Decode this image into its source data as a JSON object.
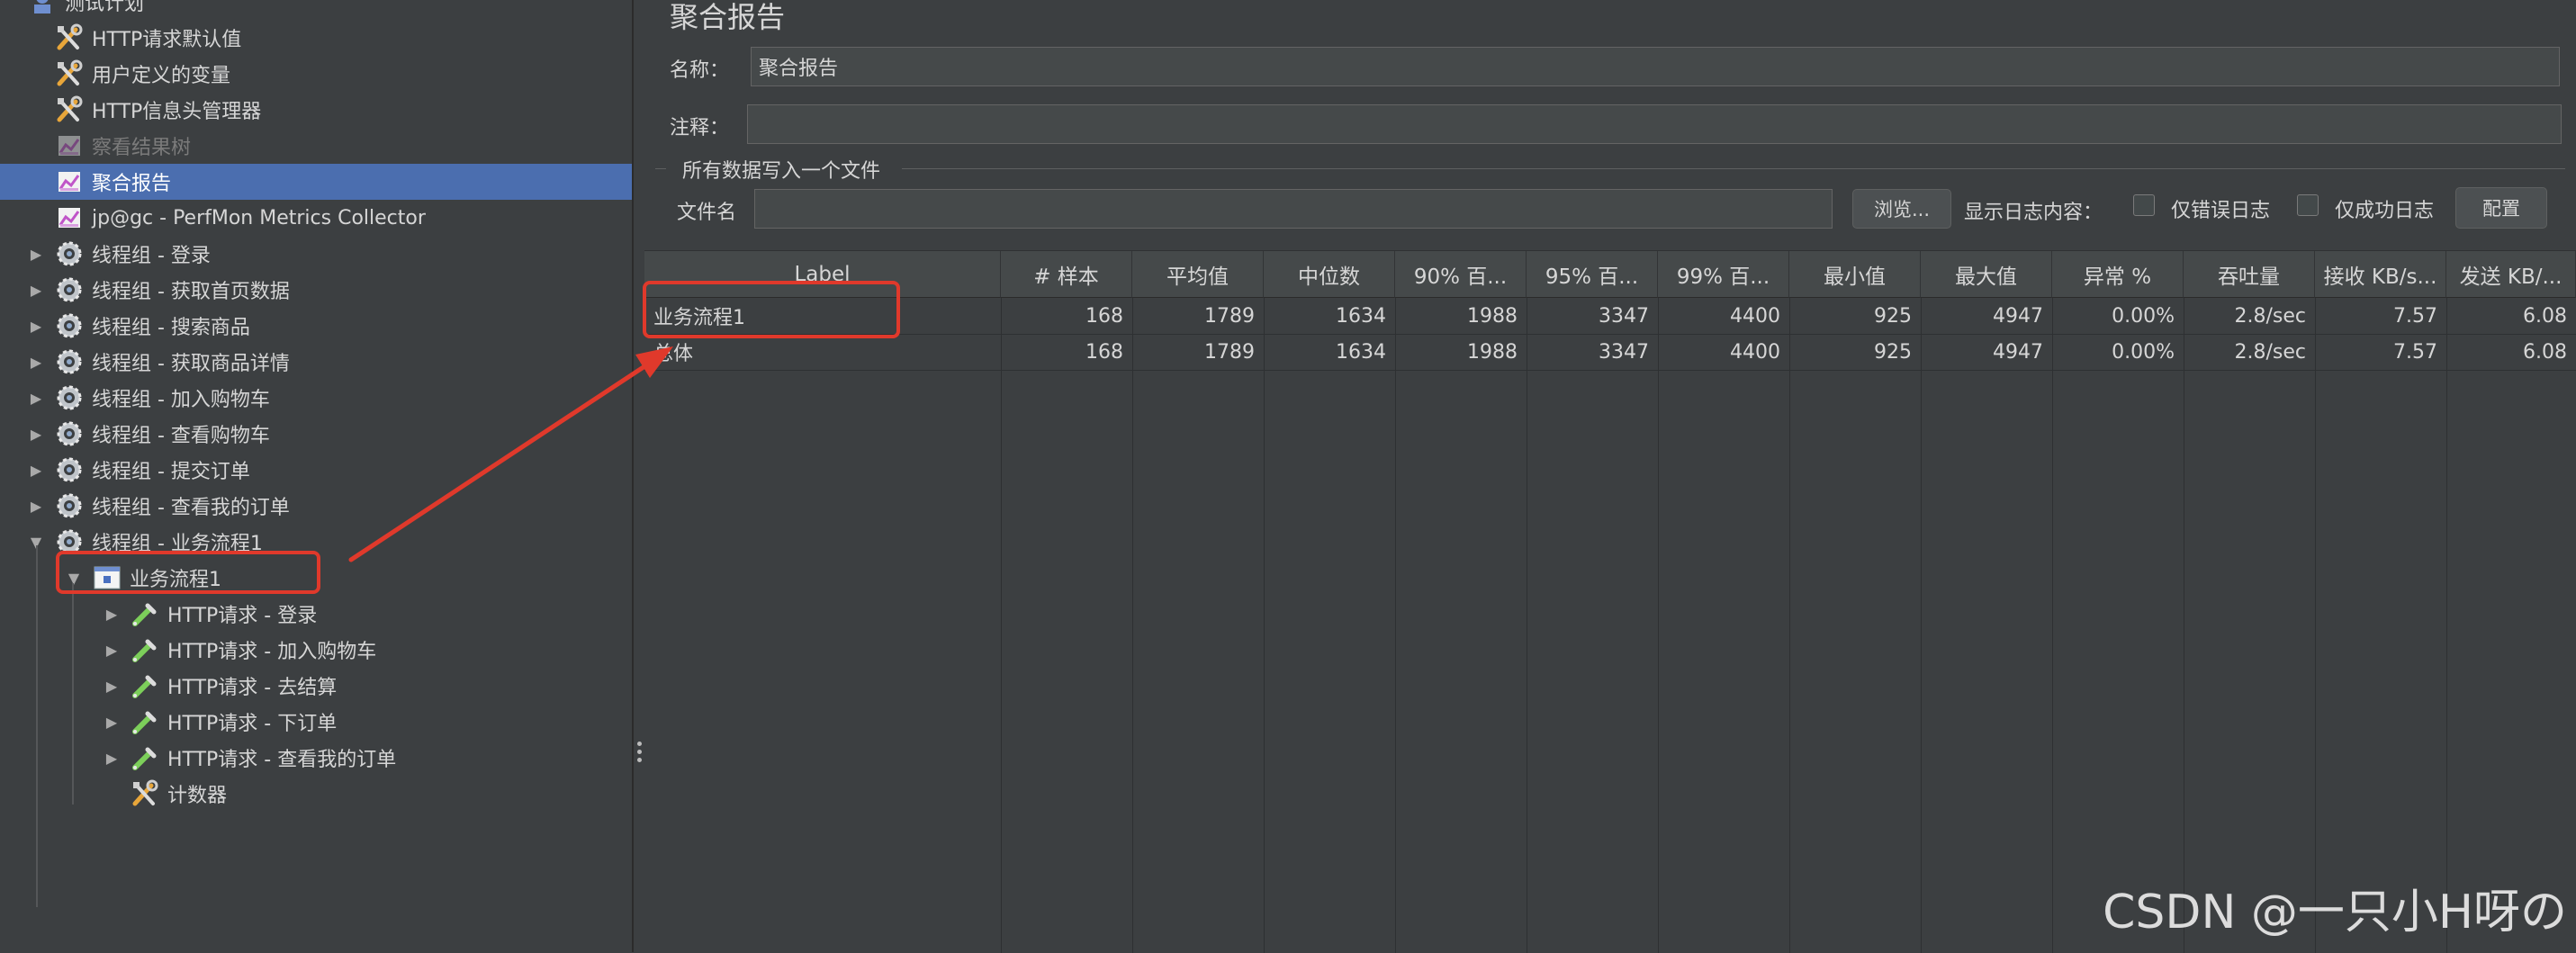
{
  "tree": {
    "items": [
      {
        "label": "测试计划",
        "level": 0,
        "icon": "test-plan-icon"
      },
      {
        "label": "HTTP请求默认值",
        "level": 1,
        "icon": "wrench-icon"
      },
      {
        "label": "用户定义的变量",
        "level": 1,
        "icon": "wrench-icon"
      },
      {
        "label": "HTTP信息头管理器",
        "level": 1,
        "icon": "wrench-icon"
      },
      {
        "label": "察看结果树",
        "level": 1,
        "icon": "listener-chart-icon",
        "disabled": true
      },
      {
        "label": "聚合报告",
        "level": 1,
        "icon": "listener-chart-icon",
        "selected": true
      },
      {
        "label": "jp@gc - PerfMon Metrics Collector",
        "level": 1,
        "icon": "listener-chart-icon"
      },
      {
        "label": "线程组 - 登录",
        "level": 1,
        "icon": "gear-icon",
        "expandable": true
      },
      {
        "label": "线程组 - 获取首页数据",
        "level": 1,
        "icon": "gear-icon",
        "expandable": true
      },
      {
        "label": "线程组 - 搜索商品",
        "level": 1,
        "icon": "gear-icon",
        "expandable": true
      },
      {
        "label": "线程组 - 获取商品详情",
        "level": 1,
        "icon": "gear-icon",
        "expandable": true
      },
      {
        "label": "线程组 - 加入购物车",
        "level": 1,
        "icon": "gear-icon",
        "expandable": true
      },
      {
        "label": "线程组 - 查看购物车",
        "level": 1,
        "icon": "gear-icon",
        "expandable": true
      },
      {
        "label": "线程组 - 提交订单",
        "level": 1,
        "icon": "gear-icon",
        "expandable": true
      },
      {
        "label": "线程组 - 查看我的订单",
        "level": 1,
        "icon": "gear-icon",
        "expandable": true
      },
      {
        "label": "线程组 - 业务流程1",
        "level": 1,
        "icon": "gear-icon",
        "expandable": true,
        "expanded": true
      },
      {
        "label": "业务流程1",
        "level": 2,
        "icon": "transaction-controller-icon",
        "expandable": true,
        "expanded": true
      },
      {
        "label": "HTTP请求 - 登录",
        "level": 3,
        "icon": "pipette-icon",
        "expandable": true
      },
      {
        "label": "HTTP请求 - 加入购物车",
        "level": 3,
        "icon": "pipette-icon",
        "expandable": true
      },
      {
        "label": "HTTP请求 - 去结算",
        "level": 3,
        "icon": "pipette-icon",
        "expandable": true
      },
      {
        "label": "HTTP请求 - 下订单",
        "level": 3,
        "icon": "pipette-icon",
        "expandable": true
      },
      {
        "label": "HTTP请求 - 查看我的订单",
        "level": 3,
        "icon": "pipette-icon",
        "expandable": true
      },
      {
        "label": "计数器",
        "level": 3,
        "icon": "wrench-icon"
      }
    ]
  },
  "panel": {
    "title": "聚合报告",
    "name_label": "名称：",
    "name_value": "聚合报告",
    "comment_label": "注释：",
    "comment_value": "",
    "file_section_title": "所有数据写入一个文件",
    "file_label": "文件名",
    "file_value": "",
    "browse_button": "浏览...",
    "log_content_label": "显示日志内容：",
    "errors_only_label": "仅错误日志",
    "success_only_label": "仅成功日志",
    "configure_button": "配置"
  },
  "table": {
    "columns": [
      "Label",
      "# 样本",
      "平均值",
      "中位数",
      "90% 百...",
      "95% 百...",
      "99% 百...",
      "最小值",
      "最大值",
      "异常 %",
      "吞吐量",
      "接收 KB/s...",
      "发送 KB/..."
    ],
    "rows": [
      [
        "业务流程1",
        "168",
        "1789",
        "1634",
        "1988",
        "3347",
        "4400",
        "925",
        "4947",
        "0.00%",
        "2.8/sec",
        "7.57",
        "6.08"
      ],
      [
        "总体",
        "168",
        "1789",
        "1634",
        "1988",
        "3347",
        "4400",
        "925",
        "4947",
        "0.00%",
        "2.8/sec",
        "7.57",
        "6.08"
      ]
    ]
  },
  "colors": {
    "background": "#3c3f41",
    "selection": "#4b6eaf",
    "annotation_red": "#e0392b"
  },
  "watermark": "CSDN @一只小H呀の"
}
